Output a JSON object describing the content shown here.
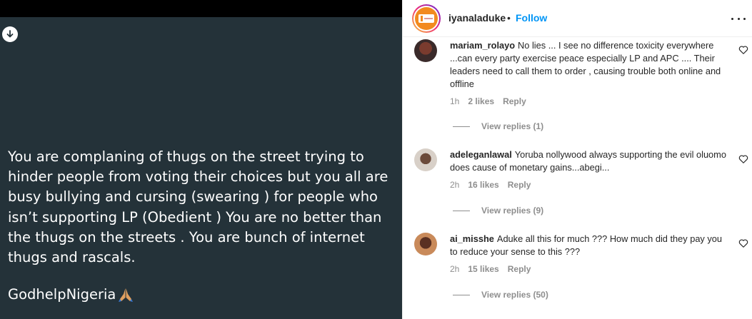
{
  "post": {
    "text": "You are complaning of thugs on the street trying to hinder people from voting their choices but you all are busy bullying and cursing (swearing ) for people who isn’t supporting LP (Obedient ) You are no better than the thugs on the streets . You are bunch of internet thugs and rascals.",
    "tag": "GodhelpNigeria"
  },
  "header": {
    "username": "iyanaladuke",
    "separator": "•",
    "follow_label": "Follow",
    "logo_color": "#f28a1f"
  },
  "comments": [
    {
      "username": "mariam_rolayo",
      "text": "No lies ... I see no difference toxicity everywhere ...can every party exercise peace especially LP and APC .... Their leaders need to call them to order , causing trouble both online and offline",
      "time": "1h",
      "likes": "2 likes",
      "reply_label": "Reply",
      "view_replies": "View replies (1)"
    },
    {
      "username": "adeleganlawal",
      "text": "Yoruba nollywood always supporting the evil oluomo does cause of monetary gains...abegi...",
      "time": "2h",
      "likes": "16 likes",
      "reply_label": "Reply",
      "view_replies": "View replies (9)"
    },
    {
      "username": "ai_misshe",
      "text": "Aduke all this for much ??? How much did they pay you to reduce your sense to this ???",
      "time": "2h",
      "likes": "15 likes",
      "reply_label": "Reply",
      "view_replies": "View replies (50)"
    }
  ],
  "colors": {
    "post_bg": "#243239",
    "link": "#0095f6",
    "muted": "#8e8e8e"
  }
}
